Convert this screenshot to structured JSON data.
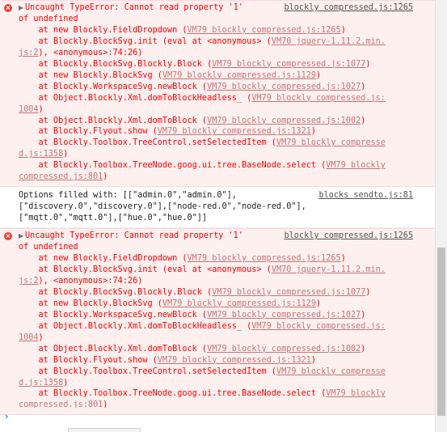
{
  "messages": [
    {
      "type": "error",
      "header": "Uncaught TypeError: Cannot read property '1'",
      "header_cont": "of undefined",
      "source": "blockly compressed.js:1265",
      "stack": [
        {
          "prefix": "    at new Blockly.FieldDropdown (",
          "link": "VM79 blockly compressed.js:1265",
          "suffix": ")"
        },
        {
          "prefix": "    at Blockly.BlockSvg.init (eval at <anonymous> (",
          "link": "VM70 jquery-1.11.2.min.",
          "suffix": ""
        },
        {
          "prefix": "",
          "link": "js:2",
          "suffix": "), <anonymous>:74:26)"
        },
        {
          "prefix": "    at Blockly.BlockSvg.Blockly.Block (",
          "link": "VM79 blockly compressed.js:1077",
          "suffix": ")"
        },
        {
          "prefix": "    at new Blockly.BlockSvg (",
          "link": "VM79 blockly compressed.js:1129",
          "suffix": ")"
        },
        {
          "prefix": "    at Blockly.WorkspaceSvg.newBlock (",
          "link": "VM79 blockly compressed.js:1027",
          "suffix": ")"
        },
        {
          "prefix": "    at Object.Blockly.Xml.domToBlockHeadless_ (",
          "link": "VM79 blockly compressed.js:",
          "suffix": ""
        },
        {
          "prefix": "",
          "link": "1004",
          "suffix": ")"
        },
        {
          "prefix": "    at Object.Blockly.Xml.domToBlock (",
          "link": "VM79 blockly compressed.js:1002",
          "suffix": ")"
        },
        {
          "prefix": "    at Blockly.Flyout.show (",
          "link": "VM79 blockly compressed.js:1321",
          "suffix": ")"
        },
        {
          "prefix": "    at Blockly.Toolbox.TreeControl.setSelectedItem (",
          "link": "VM79 blockly compresse",
          "suffix": ""
        },
        {
          "prefix": "",
          "link": "d.js:1358",
          "suffix": ")"
        },
        {
          "prefix": "    at Blockly.Toolbox.TreeNode.goog.ui.tree.BaseNode.select (",
          "link": "VM79 blockly",
          "suffix": ""
        },
        {
          "prefix": "",
          "link": "compressed.js:801",
          "suffix": ")"
        }
      ]
    },
    {
      "type": "log",
      "lines": [
        "Options filled with: [[\"admin.0\",\"admin.0\"],",
        "[\"discovery.0\",\"discovery.0\"],[\"node-red.0\",\"node-red.0\"],",
        "[\"mqtt.0\",\"mqtt.0\"],[\"hue.0\",\"hue.0\"]]"
      ],
      "source": "blocks sendto.js:81"
    },
    {
      "type": "error",
      "header": "Uncaught TypeError: Cannot read property '1'",
      "header_cont": "of undefined",
      "source": "blockly compressed.js:1265",
      "stack": [
        {
          "prefix": "    at new Blockly.FieldDropdown (",
          "link": "VM79 blockly compressed.js:1265",
          "suffix": ")"
        },
        {
          "prefix": "    at Blockly.BlockSvg.init (eval at <anonymous> (",
          "link": "VM70 jquery-1.11.2.min.",
          "suffix": ""
        },
        {
          "prefix": "",
          "link": "js:2",
          "suffix": "), <anonymous>:74:26)"
        },
        {
          "prefix": "    at Blockly.BlockSvg.Blockly.Block (",
          "link": "VM79 blockly compressed.js:1077",
          "suffix": ")"
        },
        {
          "prefix": "    at new Blockly.BlockSvg (",
          "link": "VM79 blockly compressed.js:1129",
          "suffix": ")"
        },
        {
          "prefix": "    at Blockly.WorkspaceSvg.newBlock (",
          "link": "VM79 blockly compressed.js:1027",
          "suffix": ")"
        },
        {
          "prefix": "    at Object.Blockly.Xml.domToBlockHeadless_ (",
          "link": "VM79 blockly compressed.js:",
          "suffix": ""
        },
        {
          "prefix": "",
          "link": "1004",
          "suffix": ")"
        },
        {
          "prefix": "    at Object.Blockly.Xml.domToBlock (",
          "link": "VM79 blockly compressed.js:1002",
          "suffix": ")"
        },
        {
          "prefix": "    at Blockly.Flyout.show (",
          "link": "VM79 blockly compressed.js:1321",
          "suffix": ")"
        },
        {
          "prefix": "    at Blockly.Toolbox.TreeControl.setSelectedItem (",
          "link": "VM79 blockly compresse",
          "suffix": ""
        },
        {
          "prefix": "",
          "link": "d.js:1358",
          "suffix": ")"
        },
        {
          "prefix": "    at Blockly.Toolbox.TreeNode.goog.ui.tree.BaseNode.select (",
          "link": "VM79 blockly",
          "suffix": ""
        },
        {
          "prefix": "",
          "link": "compressed.js:801",
          "suffix": ")"
        }
      ]
    }
  ],
  "icons": {
    "error": "error-icon",
    "expand": "expand-triangle-icon",
    "prompt": "prompt-chevron-icon"
  },
  "prompt": {
    "chevron": "›",
    "value": ""
  },
  "colors": {
    "error_text": "#fe0000",
    "error_bg": "#fff0f0",
    "error_border": "#ffd6d6",
    "link_error": "#c57575",
    "source_link": "#545454",
    "prompt_accent": "#367cf1"
  }
}
